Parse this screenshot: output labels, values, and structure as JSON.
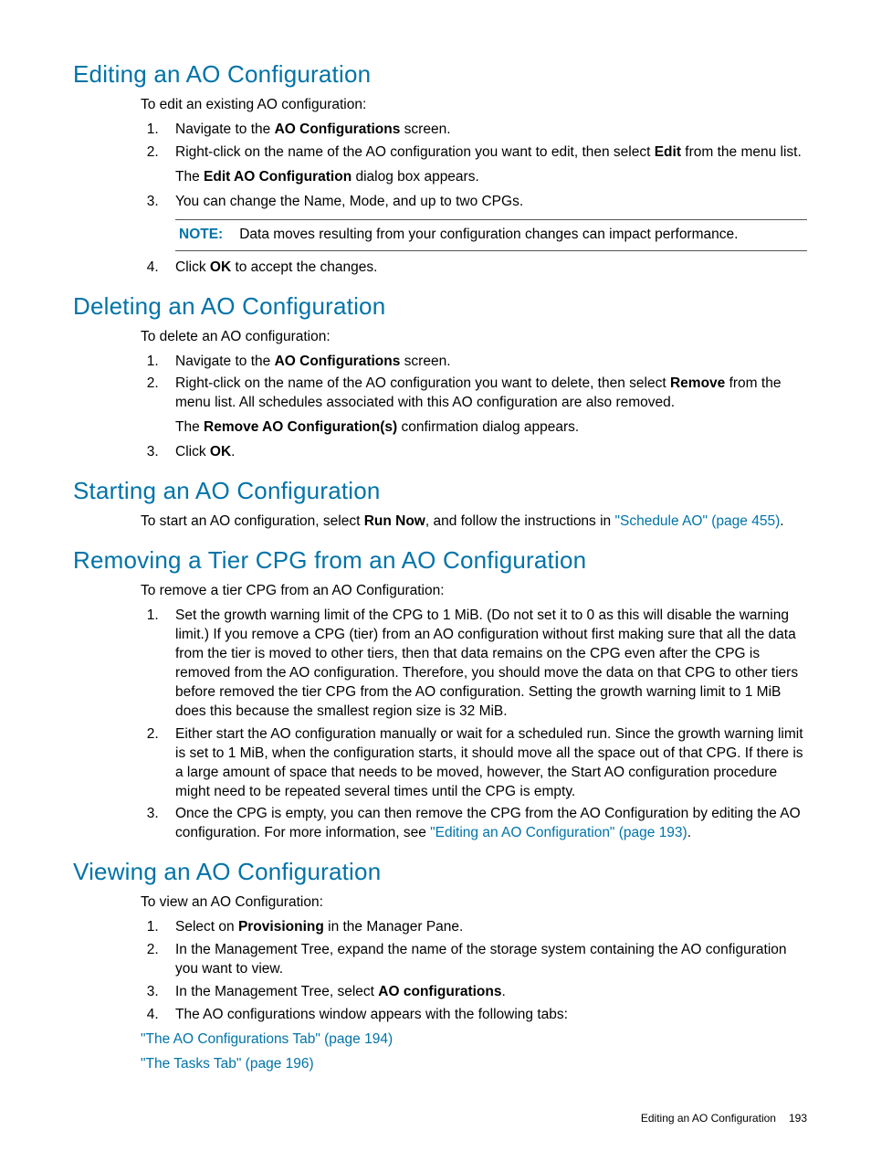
{
  "sections": {
    "edit": {
      "title": "Editing an AO Configuration",
      "intro": "To edit an existing AO configuration:",
      "step1_a": "Navigate to the ",
      "step1_b": "AO Configurations",
      "step1_c": " screen.",
      "step2_a": "Right-click on the name of the AO configuration you want to edit, then select ",
      "step2_b": "Edit",
      "step2_c": " from the menu list.",
      "step2_sub_a": "The ",
      "step2_sub_b": "Edit AO Configuration",
      "step2_sub_c": " dialog box appears.",
      "step3": "You can change the Name, Mode, and up to two CPGs.",
      "note_label": "NOTE:",
      "note_text": "Data moves resulting from your configuration changes can impact performance.",
      "step4_a": "Click ",
      "step4_b": "OK",
      "step4_c": " to accept the changes."
    },
    "delete": {
      "title": "Deleting an AO Configuration",
      "intro": "To delete an AO configuration:",
      "step1_a": "Navigate to the ",
      "step1_b": "AO Configurations",
      "step1_c": " screen.",
      "step2_a": "Right-click on the name of the AO configuration you want to delete, then select ",
      "step2_b": "Remove",
      "step2_c": " from the menu list. All schedules associated with this AO configuration are also removed.",
      "step2_sub_a": "The ",
      "step2_sub_b": "Remove AO Configuration(s)",
      "step2_sub_c": " confirmation dialog appears.",
      "step3_a": "Click ",
      "step3_b": "OK",
      "step3_c": "."
    },
    "start": {
      "title": "Starting an AO Configuration",
      "text_a": "To start an AO configuration, select ",
      "text_b": "Run Now",
      "text_c": ", and follow the instructions in ",
      "link": "\"Schedule AO\" (page 455)",
      "text_d": "."
    },
    "remove_tier": {
      "title": "Removing a Tier CPG from an AO Configuration",
      "intro": "To remove a tier CPG from an AO Configuration:",
      "step1": "Set the growth warning limit of the CPG to 1 MiB. (Do not set it to 0 as this will disable the warning limit.) If you remove a CPG (tier) from an AO configuration without first making sure that all the data from the tier is moved to other tiers, then that data remains on the CPG even after the CPG is removed from the AO configuration. Therefore, you should move the data on that CPG to other tiers before removed the tier CPG from the AO configuration. Setting the growth warning limit to 1 MiB does this because the smallest region size is 32 MiB.",
      "step2": "Either start the AO configuration manually or wait for a scheduled run. Since the growth warning limit is set to 1 MiB, when the configuration starts, it should move all the space out of that CPG. If there is a large amount of space that needs to be moved, however, the Start AO configuration procedure might need to be repeated several times until the CPG is empty.",
      "step3_a": "Once the CPG is empty, you can then remove the CPG from the AO Configuration by editing the AO configuration. For more information, see ",
      "step3_link": "\"Editing an AO Configuration\" (page 193)",
      "step3_b": "."
    },
    "view": {
      "title": "Viewing an AO Configuration",
      "intro": "To view an AO Configuration:",
      "step1_a": "Select on ",
      "step1_b": "Provisioning",
      "step1_c": " in the Manager Pane.",
      "step2": "In the Management Tree, expand the name of the storage system containing the AO configuration you want to view.",
      "step3_a": "In the Management Tree, select ",
      "step3_b": "AO configurations",
      "step3_c": ".",
      "step4": "The AO configurations window appears with the following tabs:",
      "link1": "\"The AO Configurations Tab\" (page 194)",
      "link2": "\"The Tasks Tab\" (page 196)"
    }
  },
  "footer": {
    "section": "Editing an AO Configuration",
    "page": "193"
  }
}
